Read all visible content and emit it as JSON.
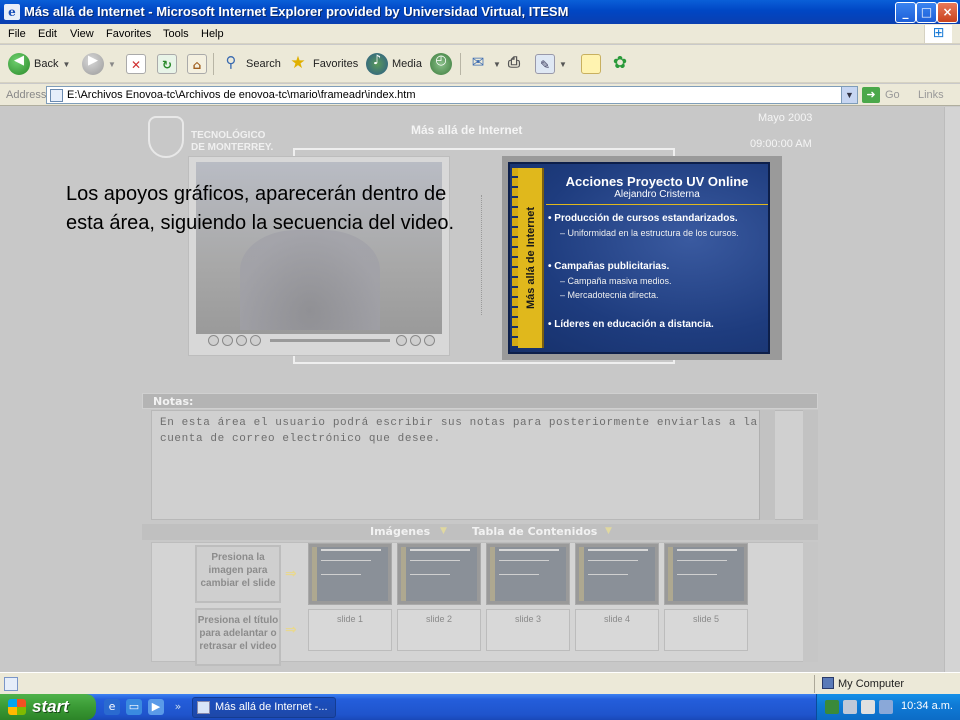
{
  "window": {
    "title": "Más allá de Internet - Microsoft Internet Explorer provided by Universidad Virtual, ITESM",
    "controls": {
      "minimize": "_",
      "maximize": "□",
      "close": "×"
    }
  },
  "menu": [
    "File",
    "Edit",
    "View",
    "Favorites",
    "Tools",
    "Help"
  ],
  "toolbar": {
    "back": "Back",
    "search": "Search",
    "favorites": "Favorites",
    "media": "Media"
  },
  "address": {
    "label": "Address",
    "value": "E:\\Archivos Enovoa-tc\\Archivos de enovoa-tc\\mario\\frameadr\\index.htm",
    "go": "Go",
    "links": "Links"
  },
  "page": {
    "logo_line1": "TECNOLÓGICO",
    "logo_line2": "DE MONTERREY.",
    "title": "Más allá de Internet",
    "date": "Mayo 2003",
    "time": "09:00:00 AM",
    "callout": "Los apoyos gráficos, aparecerán dentro de esta área, siguiendo la secuencia del video."
  },
  "slide": {
    "side_label": "Más allá de Internet",
    "title": "Acciones Proyecto UV Online",
    "subtitle": "Alejandro Cristerna",
    "bullets": [
      {
        "text": "• Producción de cursos estandarizados.",
        "sub": [
          "– Uniformidad en la estructura de los cursos."
        ]
      },
      {
        "text": "• Campañas publicitarias.",
        "sub": [
          "– Campaña masiva medios.",
          "– Mercadotecnia directa."
        ]
      },
      {
        "text": "• Líderes en educación a distancia.",
        "sub": []
      }
    ]
  },
  "notes": {
    "label": "Notas:",
    "text": "En esta área el usuario podrá escribir sus notas para posteriormente enviarlas a la cuenta de correo electrónico que desee."
  },
  "tabs": {
    "images": "Imágenes",
    "toc": "Tabla de Contenidos"
  },
  "hints": {
    "change_slide": "Presiona la imagen para cambiar el slide",
    "advance": "Presiona el título para adelantar o retrasar el video"
  },
  "thumbnails": [
    "slide 1",
    "slide 2",
    "slide 3",
    "slide 4",
    "slide 5"
  ],
  "status": {
    "zone": "My Computer"
  },
  "taskbar": {
    "start": "start",
    "task": "Más allá de Internet -...",
    "clock": "10:34 a.m."
  }
}
